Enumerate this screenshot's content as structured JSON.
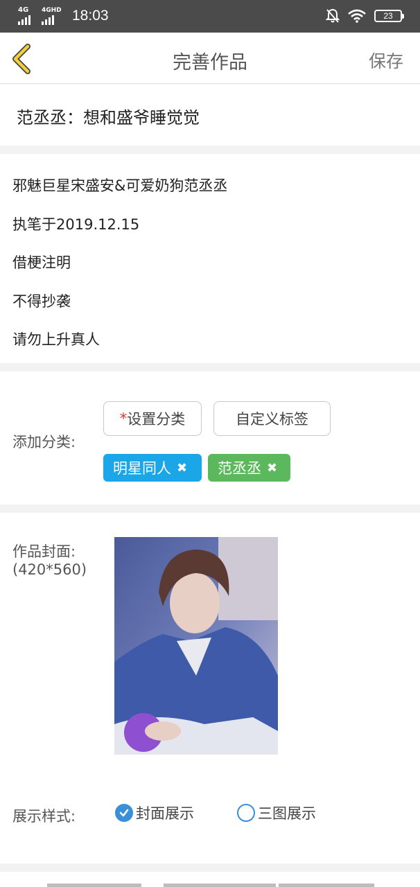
{
  "status_bar": {
    "signal1_label": "4G",
    "signal2_label": "4GHD",
    "time": "18:03",
    "battery": "23"
  },
  "header": {
    "title": "完善作品",
    "save_label": "保存"
  },
  "work_title": "范丞丞：想和盛爷睡觉觉",
  "description_lines": [
    "邪魅巨星宋盛安&可爱奶狗范丞丞",
    "执笔于2019.12.15",
    "借梗注明",
    "不得抄袭",
    "请勿上升真人"
  ],
  "category": {
    "label": "添加分类:",
    "required_mark": "*",
    "set_category_label": "设置分类",
    "custom_tag_label": "自定义标签",
    "tags": [
      {
        "name": "明星同人",
        "color": "#1ba6e8"
      },
      {
        "name": "范丞丞",
        "color": "#5cb85c"
      }
    ],
    "remove_symbol": "✖"
  },
  "cover": {
    "label": "作品封面:",
    "size_hint": "(420*560)"
  },
  "display_style": {
    "label": "展示样式:",
    "options": [
      {
        "label": "封面展示",
        "selected": true
      },
      {
        "label": "三图展示",
        "selected": false
      }
    ]
  },
  "colors": {
    "accent_blue": "#3a8fd6",
    "back_arrow": "#e8c53a"
  }
}
